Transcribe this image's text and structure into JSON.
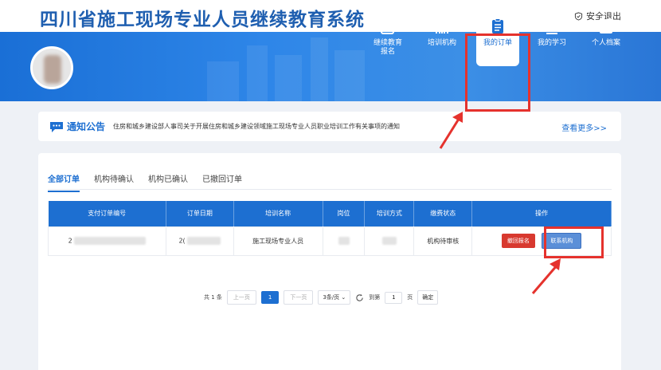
{
  "header": {
    "site_title": "四川省施工现场专业人员继续教育系统",
    "logout_label": "安全退出"
  },
  "nav": [
    {
      "label": "继续教育\n报名",
      "icon": "edit-icon"
    },
    {
      "label": "培训机构",
      "icon": "building-icon"
    },
    {
      "label": "我的订单",
      "icon": "clipboard-icon",
      "active": true
    },
    {
      "label": "我的学习",
      "icon": "video-play-icon"
    },
    {
      "label": "个人档案",
      "icon": "archive-icon"
    }
  ],
  "notice": {
    "title": "通知公告",
    "text": "住房和城乡建设部人事司关于开展住房和城乡建设领域施工现场专业人员职业培训工作有关事项的通知",
    "more": "查看更多>>"
  },
  "tabs": [
    "全部订单",
    "机构待确认",
    "机构已确认",
    "已撤回订单"
  ],
  "table": {
    "headers": [
      "支付订单编号",
      "订单日期",
      "培训名称",
      "岗位",
      "培训方式",
      "缴费状态",
      "操作"
    ],
    "rows": [
      {
        "order_no_prefix": "2",
        "date_prefix": "2(",
        "training": "施工现场专业人员",
        "status": "机构待审核",
        "btn_withdraw": "撤回报名",
        "btn_contact": "联系机构"
      }
    ]
  },
  "pager": {
    "total": "共 1 条",
    "prev": "上一页",
    "current": "1",
    "next": "下一页",
    "page_size": "3条/页",
    "goto": "到第",
    "goto_value": "1",
    "page_unit": "页",
    "confirm": "确定"
  },
  "colors": {
    "primary": "#1d6fd1",
    "highlight": "#e5322d",
    "danger": "#d8392f"
  }
}
